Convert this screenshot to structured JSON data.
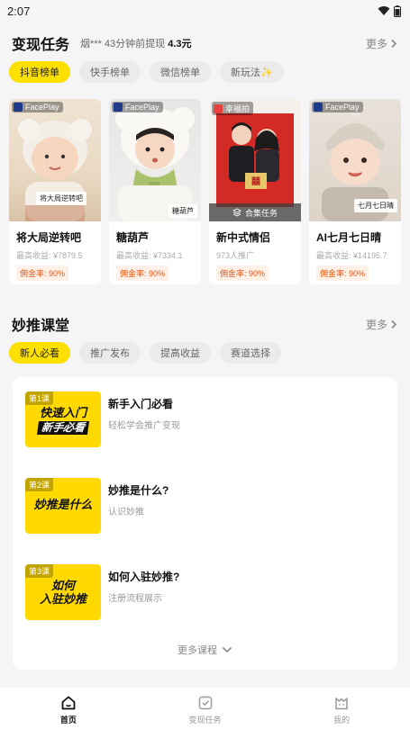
{
  "status_bar": {
    "time": "2:07"
  },
  "tasks": {
    "title": "变现任务",
    "note_prefix": "烟*** 43分钟前提现",
    "note_amount": "4.3元",
    "more": "更多",
    "tabs": [
      {
        "label": "抖音榜单",
        "active": true
      },
      {
        "label": "快手榜单",
        "active": false
      },
      {
        "label": "微信榜单",
        "active": false
      },
      {
        "label": "新玩法✨",
        "active": false
      }
    ],
    "cards": [
      {
        "brand": "FacePlay",
        "tag": "将大局逆转吧",
        "title": "将大局逆转吧",
        "sub": "最高收益: ¥7879.5",
        "commission": "佣金率: 90%"
      },
      {
        "brand": "FacePlay",
        "tag": "糖葫芦",
        "title": "糖葫芦",
        "sub": "最高收益: ¥7334.1",
        "commission": "佣金率: 90%"
      },
      {
        "brand": "幸福拍",
        "tag": "合集任务",
        "title": "新中式情侣",
        "sub": "973人推广",
        "commission": "佣金率: 90%"
      },
      {
        "brand": "FacePlay",
        "tag": "七月七日晴",
        "title": "AI七月七日晴",
        "sub": "最高收益: ¥14195.7",
        "commission": "佣金率: 90%"
      }
    ]
  },
  "classroom": {
    "title": "妙推课堂",
    "more": "更多",
    "tabs": [
      {
        "label": "新人必看",
        "active": true
      },
      {
        "label": "推广发布",
        "active": false
      },
      {
        "label": "提高收益",
        "active": false
      },
      {
        "label": "赛道选择",
        "active": false
      }
    ],
    "lessons": [
      {
        "badge": "第1课",
        "thumb_main": "快速入门",
        "thumb_sub": "新手必看",
        "title": "新手入门必看",
        "desc": "轻松学会推广变现"
      },
      {
        "badge": "第2课",
        "thumb_main": "妙推是什么",
        "thumb_sub": "",
        "title": "妙推是什么?",
        "desc": "认识妙推"
      },
      {
        "badge": "第3课",
        "thumb_main": "如何",
        "thumb_sub": "入驻妙推",
        "title": "如何入驻妙推?",
        "desc": "注册流程展示"
      }
    ],
    "more_courses": "更多课程"
  },
  "nav": {
    "items": [
      {
        "label": "首页",
        "icon": "home-icon",
        "active": true
      },
      {
        "label": "变现任务",
        "icon": "task-icon",
        "active": false
      },
      {
        "label": "我的",
        "icon": "profile-icon",
        "active": false
      }
    ]
  },
  "colors": {
    "accent": "#ffe000",
    "commission": "#e8540f",
    "background": "#f5f5f7"
  }
}
